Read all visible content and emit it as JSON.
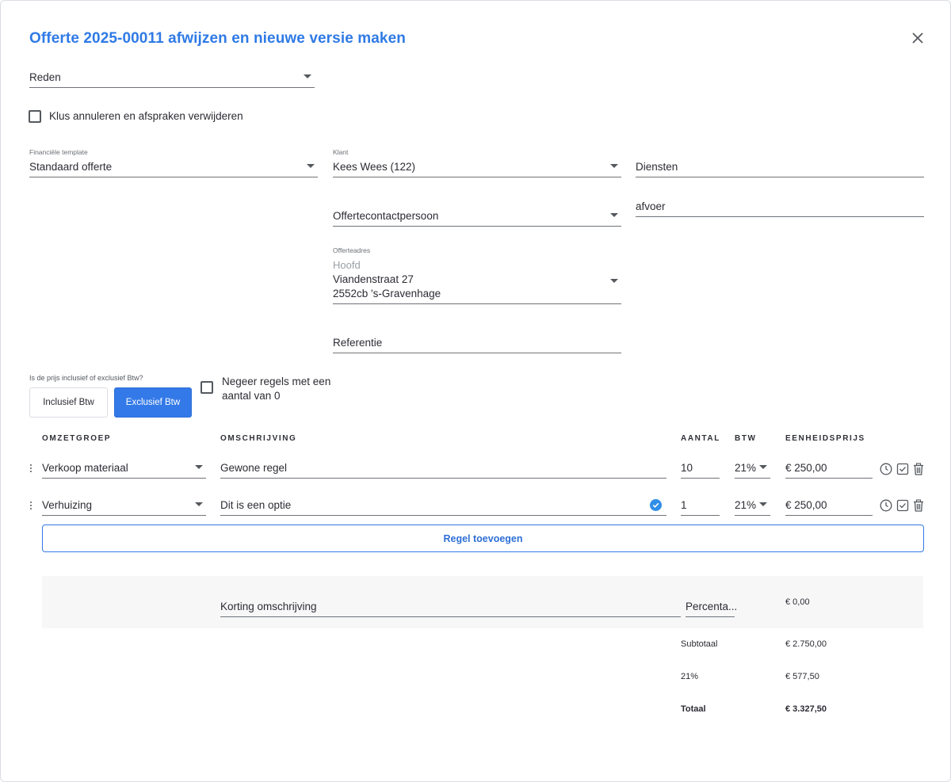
{
  "dialog": {
    "title": "Offerte 2025-00011 afwijzen en nieuwe versie maken"
  },
  "reason": {
    "value": "Reden"
  },
  "cancel_job": {
    "label": "Klus annuleren en afspraken verwijderen",
    "checked": false
  },
  "financial_template": {
    "label": "Financiële template",
    "value": "Standaard offerte"
  },
  "client": {
    "label": "Klant",
    "value": "Kees Wees (122)"
  },
  "services": {
    "value": "Diensten"
  },
  "contact_person": {
    "value": "Offertecontactpersoon"
  },
  "afvoer": {
    "value": "afvoer"
  },
  "address": {
    "label": "Offerteadres",
    "name": "Hoofd",
    "street": "Viandenstraat 27",
    "city": "2552cb 's-Gravenhage"
  },
  "reference": {
    "value": "Referentie"
  },
  "vat_question": "Is de prijs inclusief of exclusief Btw?",
  "vat_options": {
    "inclusive": "Inclusief Btw",
    "exclusive": "Exclusief Btw",
    "selected": "exclusive"
  },
  "ignore_zero": {
    "label_line1": "Negeer regels met een",
    "label_line2": "aantal van 0",
    "checked": false
  },
  "table": {
    "headers": {
      "group": "OMZETGROEP",
      "description": "OMSCHRIJVING",
      "quantity": "AANTAL",
      "vat": "BTW",
      "unit_price": "EENHEIDSPRIJS"
    },
    "rows": [
      {
        "group": "Verkoop materiaal",
        "description": "Gewone regel",
        "quantity": "10",
        "vat": "21%",
        "price": "€ 250,00",
        "option": false
      },
      {
        "group": "Verhuizing",
        "description": "Dit is een optie",
        "quantity": "1",
        "vat": "21%",
        "price": "€ 250,00",
        "option": true
      }
    ],
    "add_button": "Regel toevoegen"
  },
  "discount": {
    "description": "Korting omschrijving",
    "type": "Percenta...",
    "amount": "€ 0,00"
  },
  "totals": {
    "subtotal_label": "Subtotaal",
    "subtotal_value": "€ 2.750,00",
    "vat_label": "21%",
    "vat_value": "€ 577,50",
    "total_label": "Totaal",
    "total_value": "€ 3.327,50"
  },
  "colors": {
    "accent": "#3379e8",
    "title": "#2f7ae5",
    "option_check": "#2f8ee8"
  }
}
